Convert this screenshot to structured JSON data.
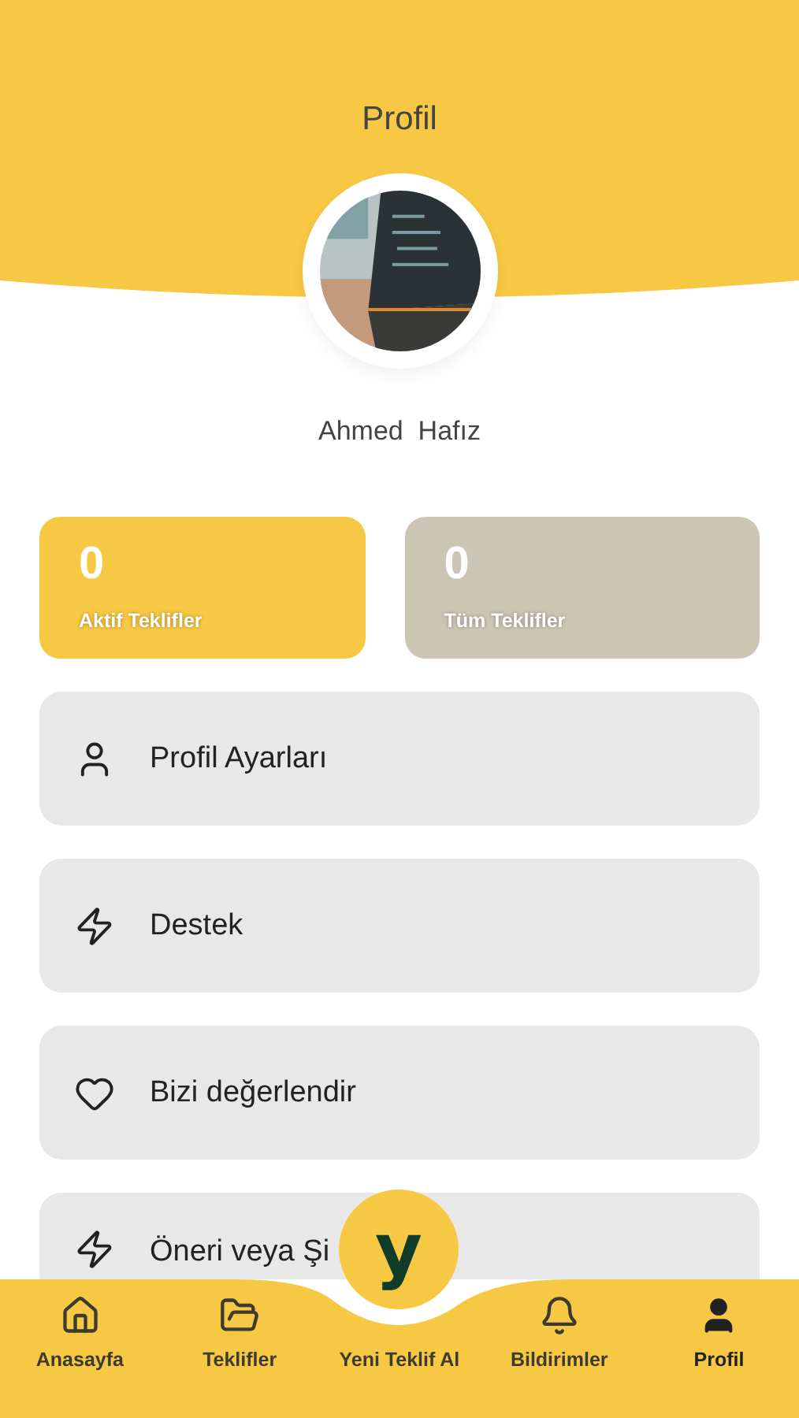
{
  "header": {
    "title": "Profil"
  },
  "profile": {
    "name": "Ahmed  Hafız"
  },
  "stats": [
    {
      "value": "0",
      "label": "Aktif Teklifler",
      "selected": true
    },
    {
      "value": "0",
      "label": "Tüm Teklifler",
      "selected": false
    }
  ],
  "menu": [
    {
      "label": "Profil Ayarları"
    },
    {
      "label": "Destek"
    },
    {
      "label": "Bizi değerlendir"
    },
    {
      "label": "Öneri veya Şi"
    }
  ],
  "bottom_nav": [
    {
      "label": "Anasayfa",
      "selected": false
    },
    {
      "label": "Teklifler",
      "selected": false
    },
    {
      "label": "Yeni Teklif Al",
      "selected": false,
      "kind": "center",
      "logo": "y"
    },
    {
      "label": "Bildirimler",
      "selected": false
    },
    {
      "label": "Profil",
      "selected": true
    }
  ]
}
